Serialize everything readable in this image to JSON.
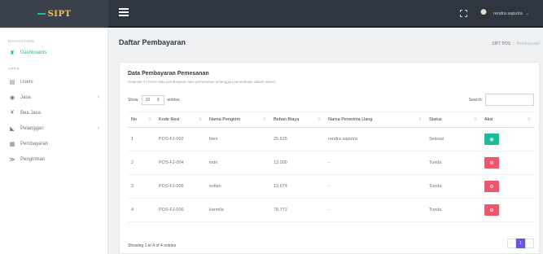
{
  "brand": {
    "name": "SIPT"
  },
  "user": {
    "name": "rendra saputra",
    "caret": "⌄"
  },
  "sidebar": {
    "heading_navigation": "NAVIGATION",
    "heading_apps": "APPS",
    "dashboard": {
      "label": "Dashboards",
      "icon": "home-icon"
    },
    "items": [
      {
        "label": "Users",
        "icon": "users-icon",
        "arrow": ""
      },
      {
        "label": "Jasa",
        "icon": "briefcase-icon",
        "arrow": "›"
      },
      {
        "label": "Bea Jasa",
        "icon": "yen-icon",
        "arrow": ""
      },
      {
        "label": "Pelanggan",
        "icon": "chart-icon",
        "arrow": "›"
      },
      {
        "label": "Pembayaran",
        "icon": "building-icon",
        "arrow": ""
      },
      {
        "label": "Pengiriman",
        "icon": "send-icon",
        "arrow": ""
      }
    ]
  },
  "page": {
    "title": "Daftar Pembayaran",
    "breadcrumb": {
      "root": "SIPT POS",
      "sep": "/",
      "current": "Pembayaran"
    }
  },
  "card": {
    "title": "Data Pembayaran Pemesanan",
    "subtitle": "Halaman ini berisi data pembayaran atas pemesanan pelanggan perusahaan dalam sistem"
  },
  "table_controls": {
    "show_label": "Show",
    "entries_label": "entries",
    "length_value": "10",
    "search_label": "Search:",
    "search_value": ""
  },
  "table": {
    "headers": [
      "No",
      "Kode Resi",
      "Nama Pengirim",
      "Beban Biaya",
      "Nama Penerima Uang",
      "Status",
      "Aksi"
    ],
    "rows": [
      {
        "no": "1",
        "kode": "POS-FJ-002",
        "pengirim": "beni",
        "biaya": "25,625",
        "penerima": "rendra saputra",
        "status": "Selesai",
        "action": "green"
      },
      {
        "no": "2",
        "kode": "POS-FJ-004",
        "pengirim": "indri",
        "biaya": "13,000",
        "penerima": "-",
        "status": "Tunda",
        "action": "red"
      },
      {
        "no": "3",
        "kode": "POS-FJ-005",
        "pengirim": "sofian",
        "biaya": "13,674",
        "penerima": "-",
        "status": "Tunda",
        "action": "red"
      },
      {
        "no": "4",
        "kode": "POS-FJ-006",
        "pengirim": "karmila",
        "biaya": "78,772",
        "penerima": "-",
        "status": "Tunda",
        "action": "red"
      }
    ]
  },
  "footer": {
    "info": "Showing 1 to 4 of 4 entries",
    "pagination": {
      "prev": "‹",
      "page": "1",
      "next": "›"
    }
  },
  "colors": {
    "accent": "#1abc9c",
    "danger": "#f1556c",
    "primary": "#6658dd",
    "topbar": "#2f3640"
  }
}
